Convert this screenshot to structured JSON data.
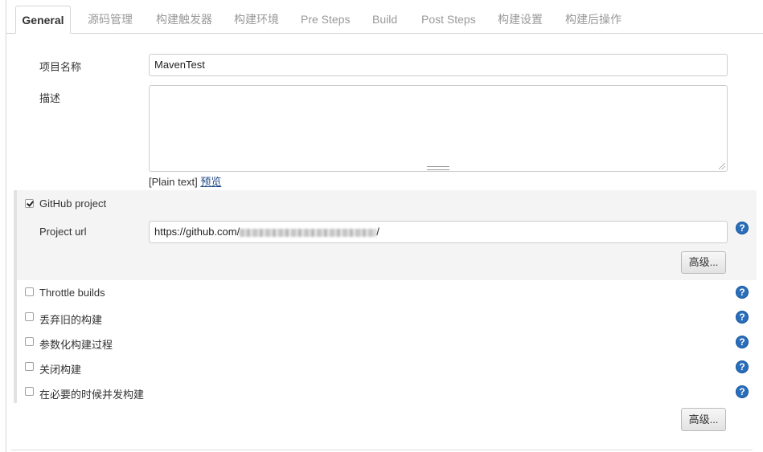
{
  "tabs": [
    {
      "label": "General",
      "active": true
    },
    {
      "label": "源码管理"
    },
    {
      "label": "构建触发器"
    },
    {
      "label": "构建环境"
    },
    {
      "label": "Pre Steps"
    },
    {
      "label": "Build"
    },
    {
      "label": "Post Steps"
    },
    {
      "label": "构建设置"
    },
    {
      "label": "构建后操作"
    }
  ],
  "form": {
    "project_name_label": "项目名称",
    "project_name_value": "MavenTest",
    "description_label": "描述",
    "description_value": "",
    "plain_text": "[Plain text]",
    "preview_link": "预览"
  },
  "github": {
    "checkbox_label": "GitHub project",
    "checked": true,
    "url_label": "Project url",
    "url_prefix": "https://github.com/",
    "url_suffix": "/",
    "advanced_label": "高级..."
  },
  "options": [
    {
      "label": "Throttle builds",
      "checked": false
    },
    {
      "label": "丢弃旧的构建",
      "checked": false
    },
    {
      "label": "参数化构建过程",
      "checked": false
    },
    {
      "label": "关闭构建",
      "checked": false
    },
    {
      "label": "在必要的时候并发构建",
      "checked": false
    }
  ],
  "advanced_bottom_label": "高级...",
  "help_glyph": "?",
  "icons": {
    "help": "help-icon",
    "checkbox": "checkbox"
  },
  "colors": {
    "help_blue": "#2a6ebb",
    "link": "#204a87"
  }
}
